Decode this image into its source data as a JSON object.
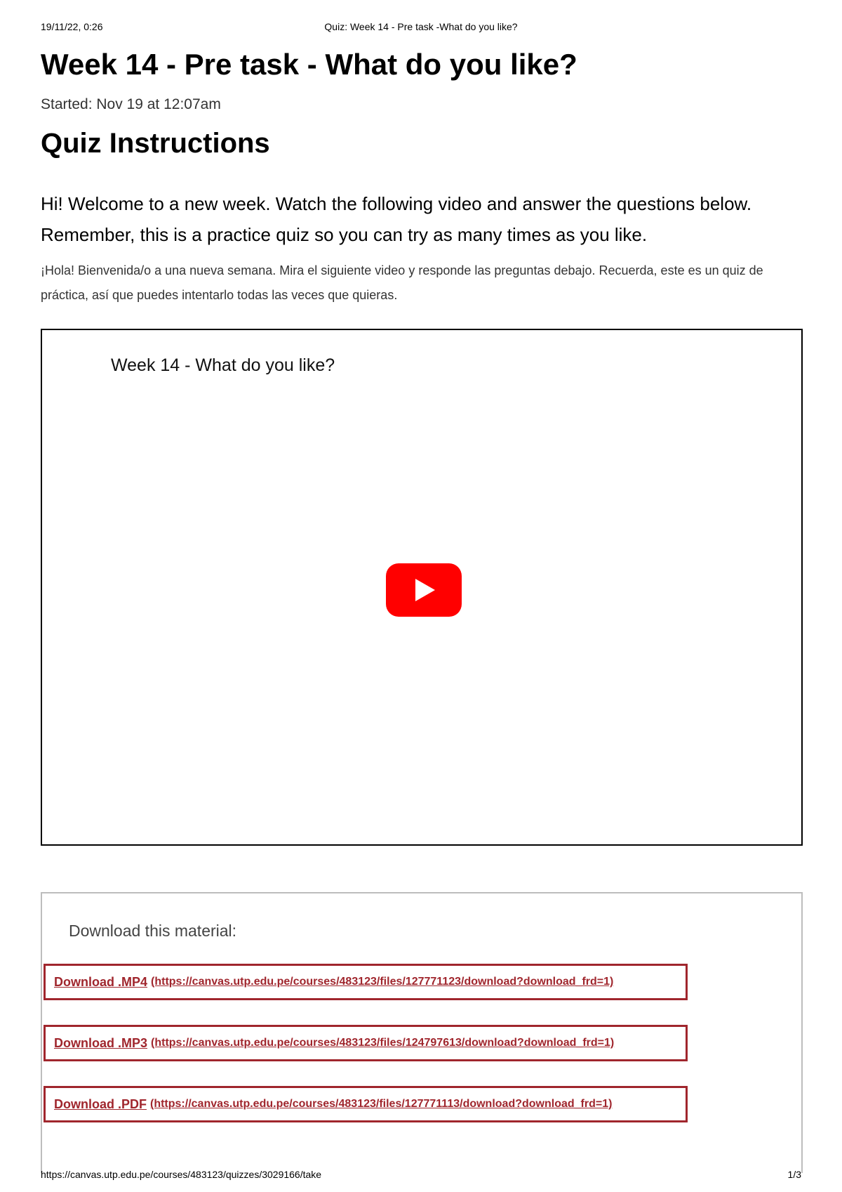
{
  "print_header": {
    "date": "19/11/22, 0:26",
    "document_title": "Quiz: Week 14 - Pre task -What do you like?"
  },
  "quiz": {
    "title": "Week 14 - Pre task - What do you like?",
    "started": "Started: Nov 19 at 12:07am",
    "instructions_heading": "Quiz Instructions",
    "intro_en": "Hi! Welcome to a new week. Watch the following video and answer the questions below. Remember, this is a practice quiz so you can try as many times as you like.",
    "intro_es": "¡Hola! Bienvenida/o a una nueva semana. Mira el siguiente video y responde las preguntas debajo. Recuerda, este es un quiz de práctica, así que puedes intentarlo todas las veces que quieras."
  },
  "video": {
    "title": "Week 14 - What do you like?",
    "play_icon": "play-icon",
    "play_color": "#ff0000"
  },
  "downloads": {
    "label": "Download this material:",
    "link_color": "#a0262d",
    "links": [
      {
        "name": "Download .MP4",
        "url": "(https://canvas.utp.edu.pe/courses/483123/files/127771123/download?download_frd=1)"
      },
      {
        "name": "Download .MP3",
        "url": "(https://canvas.utp.edu.pe/courses/483123/files/124797613/download?download_frd=1)"
      },
      {
        "name": "Download .PDF",
        "url": "(https://canvas.utp.edu.pe/courses/483123/files/127771113/download?download_frd=1)"
      }
    ]
  },
  "print_footer": {
    "url": "https://canvas.utp.edu.pe/courses/483123/quizzes/3029166/take",
    "page": "1/3"
  }
}
